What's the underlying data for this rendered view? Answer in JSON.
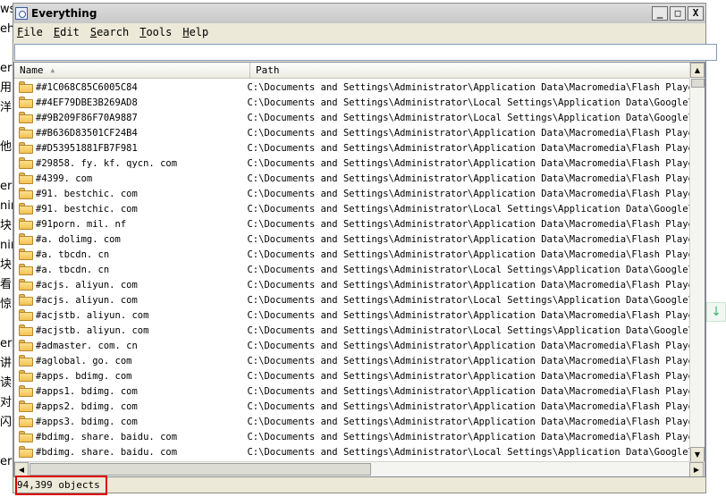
{
  "background_left_chars": [
    "ws",
    "eh",
    "",
    "er",
    "用",
    "洋",
    "",
    "他",
    "",
    "er",
    "nir",
    "块",
    "nir",
    "块",
    "看",
    "惊",
    "",
    "er",
    "讲",
    "读",
    "对",
    "闪",
    "",
    "er"
  ],
  "window": {
    "title": "Everything",
    "buttons": {
      "minimize": "_",
      "maximize": "□",
      "close": "X"
    }
  },
  "menu": [
    {
      "label": "File",
      "accel": "F",
      "rest": "ile"
    },
    {
      "label": "Edit",
      "accel": "E",
      "rest": "dit"
    },
    {
      "label": "Search",
      "accel": "S",
      "rest": "earch"
    },
    {
      "label": "Tools",
      "accel": "T",
      "rest": "ools"
    },
    {
      "label": "Help",
      "accel": "H",
      "rest": "elp"
    }
  ],
  "search": {
    "value": "",
    "placeholder": ""
  },
  "columns": {
    "name": "Name",
    "path": "Path"
  },
  "rows": [
    {
      "name": "##1C068C85C6005C84",
      "path": "C:\\Documents and Settings\\Administrator\\Application Data\\Macromedia\\Flash Player\\#Sh"
    },
    {
      "name": "##4EF79DBE3B269AD8",
      "path": "C:\\Documents and Settings\\Administrator\\Local Settings\\Application Data\\Google\\Chrom"
    },
    {
      "name": "##9B209F86F70A9887",
      "path": "C:\\Documents and Settings\\Administrator\\Local Settings\\Application Data\\Google\\Chrom"
    },
    {
      "name": "##B636D83501CF24B4",
      "path": "C:\\Documents and Settings\\Administrator\\Application Data\\Macromedia\\Flash Player\\#Sh"
    },
    {
      "name": "##D53951881FB7F981",
      "path": "C:\\Documents and Settings\\Administrator\\Application Data\\Macromedia\\Flash Player\\#Sh"
    },
    {
      "name": "#29858. fy. kf. qycn. com",
      "path": "C:\\Documents and Settings\\Administrator\\Application Data\\Macromedia\\Flash Player\\mac"
    },
    {
      "name": "#4399. com",
      "path": "C:\\Documents and Settings\\Administrator\\Application Data\\Macromedia\\Flash Player\\mac"
    },
    {
      "name": "#91. bestchic. com",
      "path": "C:\\Documents and Settings\\Administrator\\Application Data\\Macromedia\\Flash Player\\mac"
    },
    {
      "name": "#91. bestchic. com",
      "path": "C:\\Documents and Settings\\Administrator\\Local Settings\\Application Data\\Google\\Chrom"
    },
    {
      "name": "#91porn. mil. nf",
      "path": "C:\\Documents and Settings\\Administrator\\Application Data\\Macromedia\\Flash Player\\mac"
    },
    {
      "name": "#a. dolimg. com",
      "path": "C:\\Documents and Settings\\Administrator\\Application Data\\Macromedia\\Flash Player\\mac"
    },
    {
      "name": "#a. tbcdn. cn",
      "path": "C:\\Documents and Settings\\Administrator\\Application Data\\Macromedia\\Flash Player\\mac"
    },
    {
      "name": "#a. tbcdn. cn",
      "path": "C:\\Documents and Settings\\Administrator\\Local Settings\\Application Data\\Google\\Chrom"
    },
    {
      "name": "#acjs. aliyun. com",
      "path": "C:\\Documents and Settings\\Administrator\\Application Data\\Macromedia\\Flash Player\\mac"
    },
    {
      "name": "#acjs. aliyun. com",
      "path": "C:\\Documents and Settings\\Administrator\\Local Settings\\Application Data\\Google\\Chrom"
    },
    {
      "name": "#acjstb. aliyun. com",
      "path": "C:\\Documents and Settings\\Administrator\\Application Data\\Macromedia\\Flash Player\\mac"
    },
    {
      "name": "#acjstb. aliyun. com",
      "path": "C:\\Documents and Settings\\Administrator\\Local Settings\\Application Data\\Google\\Chrom"
    },
    {
      "name": "#admaster. com. cn",
      "path": "C:\\Documents and Settings\\Administrator\\Application Data\\Macromedia\\Flash Player\\mac"
    },
    {
      "name": "#aglobal. go. com",
      "path": "C:\\Documents and Settings\\Administrator\\Application Data\\Macromedia\\Flash Player\\mac"
    },
    {
      "name": "#apps. bdimg. com",
      "path": "C:\\Documents and Settings\\Administrator\\Application Data\\Macromedia\\Flash Player\\mac"
    },
    {
      "name": "#apps1. bdimg. com",
      "path": "C:\\Documents and Settings\\Administrator\\Application Data\\Macromedia\\Flash Player\\mac"
    },
    {
      "name": "#apps2. bdimg. com",
      "path": "C:\\Documents and Settings\\Administrator\\Application Data\\Macromedia\\Flash Player\\mac"
    },
    {
      "name": "#apps3. bdimg. com",
      "path": "C:\\Documents and Settings\\Administrator\\Application Data\\Macromedia\\Flash Player\\mac"
    },
    {
      "name": "#bdimg. share. baidu. com",
      "path": "C:\\Documents and Settings\\Administrator\\Application Data\\Macromedia\\Flash Player\\mac"
    },
    {
      "name": "#bdimg. share. baidu. com",
      "path": "C:\\Documents and Settings\\Administrator\\Local Settings\\Application Data\\Google\\Chrom"
    }
  ],
  "status": {
    "text": "94,399 objects"
  },
  "side_button": {
    "symbol": "↓"
  }
}
